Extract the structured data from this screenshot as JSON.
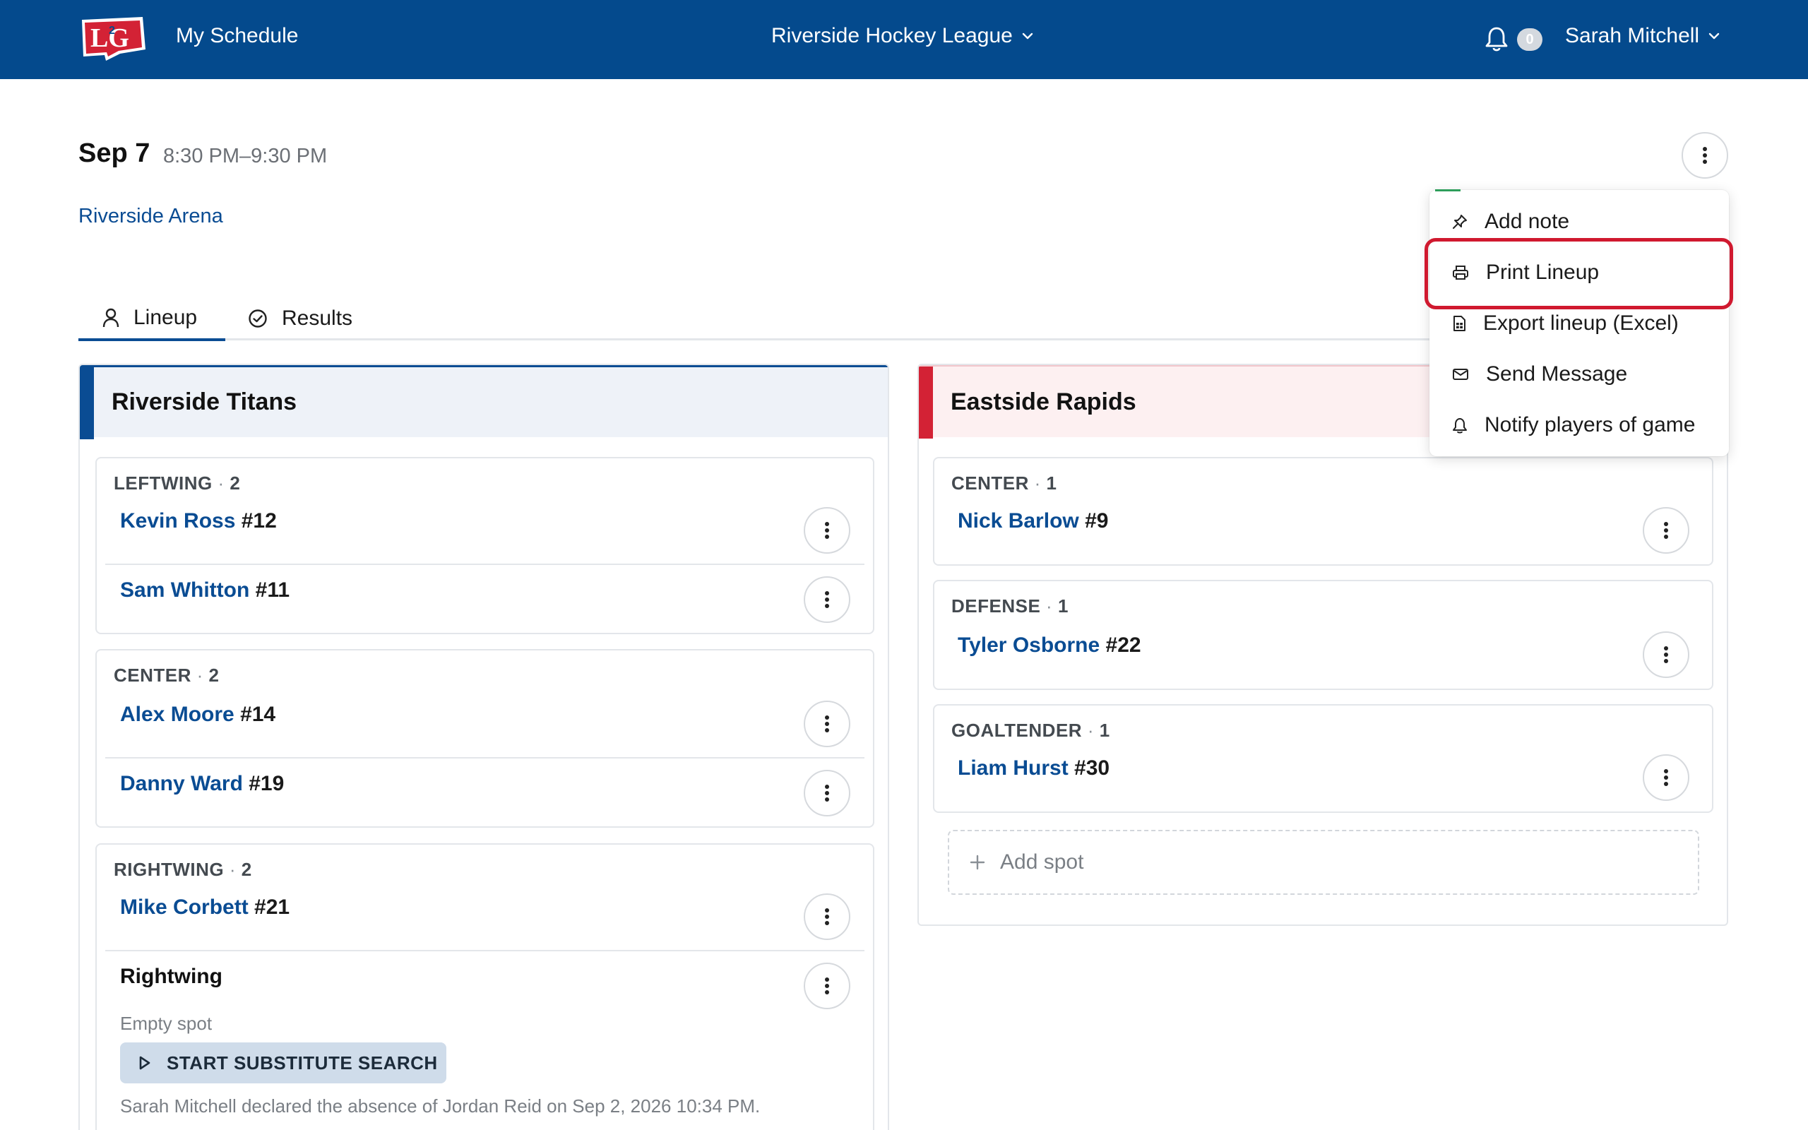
{
  "topbar": {
    "logo_text": "LG",
    "nav_title": "My Schedule",
    "league": "Riverside Hockey League",
    "notifications": "0",
    "user": "Sarah Mitchell"
  },
  "event": {
    "date": "Sep 7",
    "time": "8:30 PM–9:30 PM",
    "arena": "Riverside Arena"
  },
  "tabs": [
    {
      "label": "Lineup",
      "active": true
    },
    {
      "label": "Results",
      "active": false
    }
  ],
  "teams": {
    "home": {
      "name": "Riverside Titans",
      "color": "#0a4c93",
      "groups": [
        {
          "position": "LEFTWING",
          "count": "2",
          "players": [
            {
              "name": "Kevin Ross",
              "number": "#12"
            },
            {
              "name": "Sam Whitton",
              "number": "#11"
            }
          ]
        },
        {
          "position": "CENTER",
          "count": "2",
          "players": [
            {
              "name": "Alex Moore",
              "number": "#14"
            },
            {
              "name": "Danny Ward",
              "number": "#19"
            }
          ]
        },
        {
          "position": "RIGHTWING",
          "count": "2",
          "players": [
            {
              "name": "Mike Corbett",
              "number": "#21"
            }
          ],
          "empty_spot": {
            "title": "Rightwing",
            "subtitle": "Empty spot",
            "button": "START SUBSTITUTE SEARCH",
            "note": "Sarah Mitchell declared the absence of Jordan Reid on Sep 2, 2026 10:34 PM."
          }
        }
      ]
    },
    "away": {
      "name": "Eastside Rapids",
      "color": "#d32235",
      "groups": [
        {
          "position": "CENTER",
          "count": "1",
          "players": [
            {
              "name": "Nick Barlow",
              "number": "#9"
            }
          ]
        },
        {
          "position": "DEFENSE",
          "count": "1",
          "players": [
            {
              "name": "Tyler Osborne",
              "number": "#22"
            }
          ]
        },
        {
          "position": "GOALTENDER",
          "count": "1",
          "players": [
            {
              "name": "Liam Hurst",
              "number": "#30"
            }
          ]
        }
      ],
      "add_spot": "Add spot"
    }
  },
  "menu": {
    "items": [
      {
        "label": "Add note",
        "icon": "pin-icon"
      },
      {
        "label": "Print Lineup",
        "icon": "printer-icon",
        "highlighted": true
      },
      {
        "label": "Export lineup (Excel)",
        "icon": "spreadsheet-icon"
      },
      {
        "label": "Send Message",
        "icon": "envelope-icon"
      },
      {
        "label": "Notify players of game",
        "icon": "bell-icon"
      }
    ]
  },
  "colors": {
    "topbar": "#044a8d",
    "link": "#0a4c93",
    "home_accent": "#0a4c93",
    "away_accent": "#d32235",
    "highlight": "#d0192f"
  }
}
